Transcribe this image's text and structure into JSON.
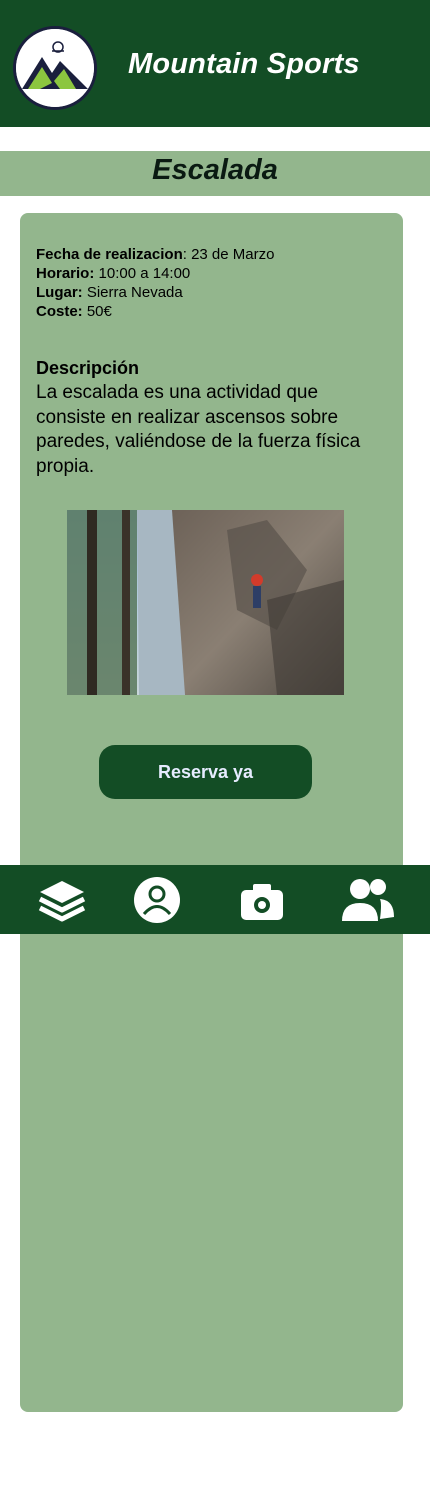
{
  "header": {
    "app_title": "Mountain Sports",
    "logo_icon": "mountain-logo-icon"
  },
  "page": {
    "title": "Escalada"
  },
  "details": {
    "date_label": "Fecha de realizacion",
    "date_value": ": 23 de Marzo",
    "schedule_label": "Horario:",
    "schedule_value": " 10:00 a 14:00",
    "place_label": "Lugar:",
    "place_value": " Sierra Nevada",
    "cost_label": "Coste:",
    "cost_value": " 50€"
  },
  "description": {
    "heading": "Descripción",
    "text": "La escalada es una actividad que consiste en realizar ascensos sobre paredes, valiéndose de la fuerza física propia."
  },
  "actions": {
    "reserve_label": "Reserva ya"
  },
  "bottom_nav": {
    "items": [
      {
        "icon": "layers-icon"
      },
      {
        "icon": "user-profile-icon"
      },
      {
        "icon": "camera-icon"
      },
      {
        "icon": "users-group-icon"
      }
    ]
  },
  "colors": {
    "primary": "#134d25",
    "secondary": "#93b68d",
    "accent_title": "#c9c4ff"
  }
}
